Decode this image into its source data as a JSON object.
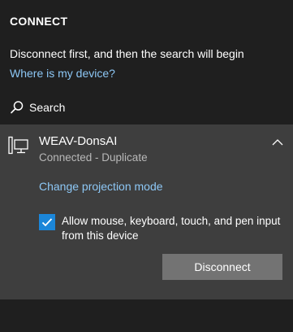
{
  "header": {
    "title": "CONNECT"
  },
  "info": {
    "message": "Disconnect first, and then the search will begin",
    "help_link": "Where is my device?"
  },
  "search": {
    "label": "Search",
    "icon": "search-icon"
  },
  "device": {
    "name": "WEAV-DonsAI",
    "status": "Connected - Duplicate",
    "icon": "display-device-icon",
    "expand_icon": "chevron-up-icon",
    "change_mode_link": "Change projection mode",
    "allow_input": {
      "checked": true,
      "label": "Allow mouse, keyboard, touch, and pen input from this device"
    },
    "disconnect_label": "Disconnect"
  },
  "colors": {
    "background": "#1f1f1f",
    "card": "#3e3e3e",
    "link": "#8dc7f5",
    "checkbox": "#1b86d9",
    "button": "#737373",
    "secondary_text": "#b8b8b8"
  }
}
